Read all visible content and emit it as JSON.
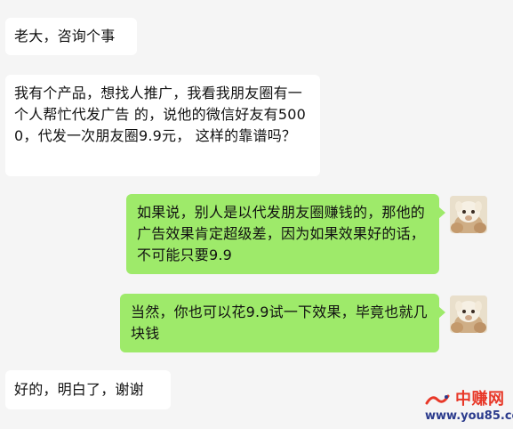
{
  "messages": [
    {
      "side": "incoming",
      "text": "老大，咨询个事"
    },
    {
      "side": "incoming",
      "text": "我有个产品，想找人推广，我看我朋友圈有一个人帮忙代发广告 的，说他的微信好友有5000，代发一次朋友圈9.9元， 这样的靠谱吗？"
    },
    {
      "side": "outgoing",
      "text": "如果说，别人是以代发朋友圈赚钱的，那他的广告效果肯定超级差，因为如果效果好的话，不可能只要9.9"
    },
    {
      "side": "outgoing",
      "text": "当然，你也可以花9.9试一下效果，毕竟也就几块钱"
    },
    {
      "side": "incoming",
      "text": "好的，明白了，谢谢"
    }
  ],
  "avatars": {
    "self": "alpaca-avatar-icon"
  },
  "watermark": {
    "name": "中赚网",
    "url": "www.you85.com"
  },
  "colors": {
    "background": "#f5f5f5",
    "incoming_bubble": "#ffffff",
    "outgoing_bubble": "#9eea6a",
    "watermark_red": "#e83828",
    "watermark_blue": "#2a3a8c"
  }
}
